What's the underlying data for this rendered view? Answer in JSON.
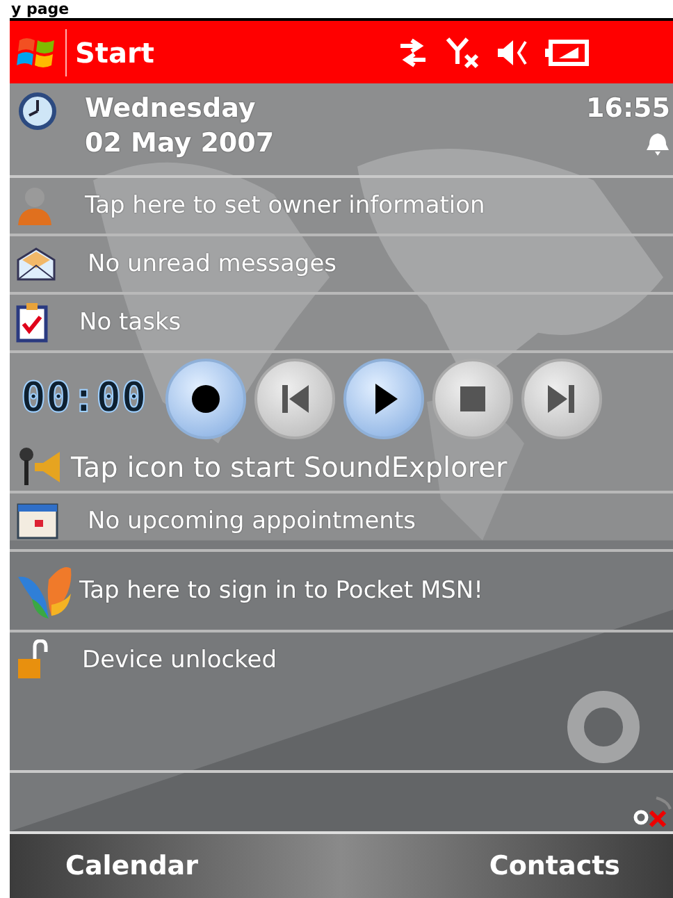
{
  "page_heading": "y page",
  "title_bar": {
    "start": "Start"
  },
  "date_row": {
    "day": "Wednesday",
    "date": "02 May 2007",
    "time": "16:55"
  },
  "today": [
    {
      "kind": "owner",
      "text": "Tap here to set owner information"
    },
    {
      "kind": "messages",
      "text": "No unread messages"
    },
    {
      "kind": "tasks",
      "text": "No tasks"
    },
    {
      "kind": "player",
      "timer": "00:00",
      "buttons": [
        {
          "kind": "record",
          "highlighted": true
        },
        {
          "kind": "previous",
          "highlighted": false
        },
        {
          "kind": "play",
          "highlighted": true
        },
        {
          "kind": "stop",
          "highlighted": false
        },
        {
          "kind": "next",
          "highlighted": false
        }
      ]
    },
    {
      "kind": "sound",
      "text": "Tap icon to start SoundExplorer"
    },
    {
      "kind": "appointments",
      "text": "No upcoming appointments"
    },
    {
      "kind": "msn",
      "text": "Tap here to sign in to Pocket MSN!"
    },
    {
      "kind": "lock",
      "text": "Device unlocked"
    }
  ],
  "softkeys": [
    "Calendar",
    "Contacts"
  ]
}
